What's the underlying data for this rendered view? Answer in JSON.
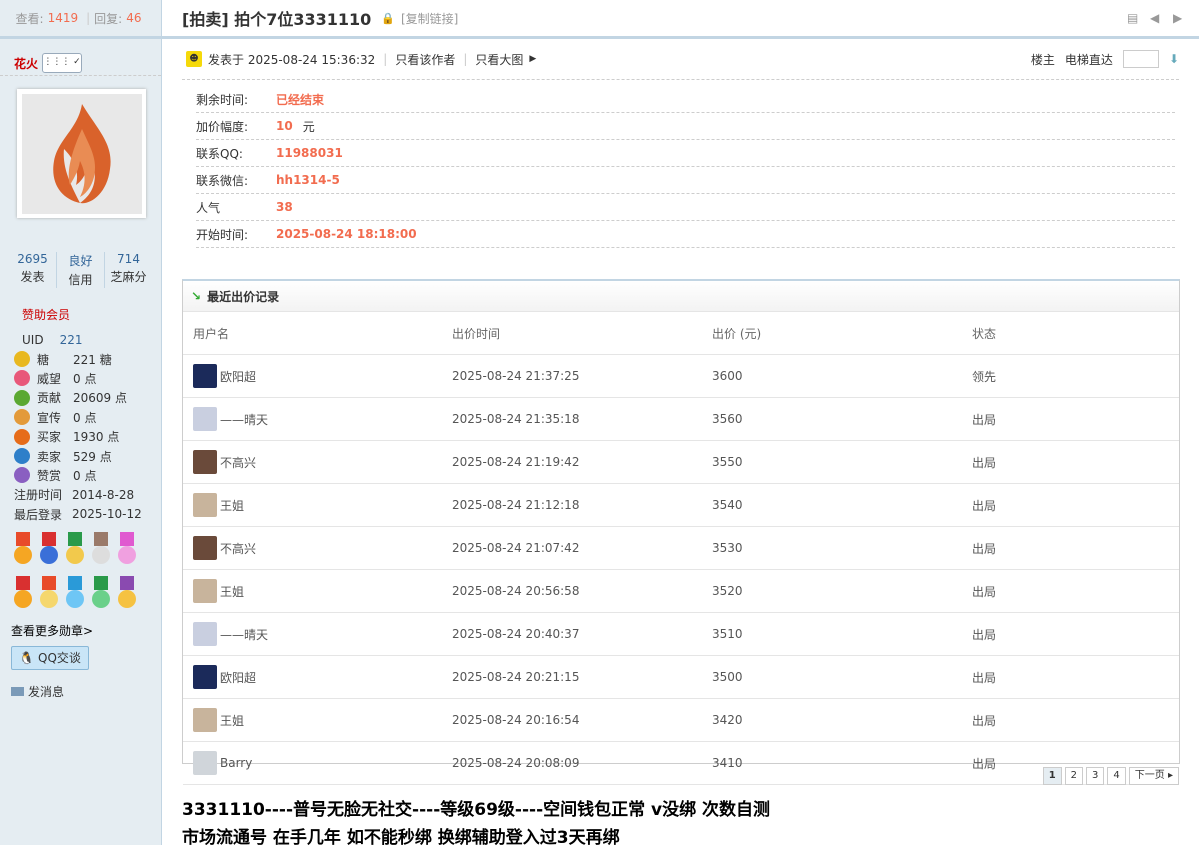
{
  "stats": {
    "views_label": "查看:",
    "views": "1419",
    "replies_label": "回复:",
    "replies": "46"
  },
  "user": {
    "name": "花火",
    "posts": "2695",
    "posts_label": "发表",
    "credit": "良好",
    "credit_label": "信用",
    "sesame": "714",
    "sesame_label": "芝麻分",
    "group": "赞助会员",
    "uid_label": "UID",
    "uid": "221",
    "info": [
      {
        "icon": "coin-icon",
        "color": "#e8b820",
        "k": "糖",
        "v": "221 糖"
      },
      {
        "icon": "heart-icon",
        "color": "#e8587a",
        "k": "威望",
        "v": "0 点"
      },
      {
        "icon": "sprout-icon",
        "color": "#5aa832",
        "k": "贡献",
        "v": "20609 点"
      },
      {
        "icon": "person-icon",
        "color": "#e39a3a",
        "k": "宣传",
        "v": "0 点"
      },
      {
        "icon": "gem-icon",
        "color": "#e66c1a",
        "k": "买家",
        "v": "1930 点"
      },
      {
        "icon": "diamond-icon",
        "color": "#2e7fc9",
        "k": "卖家",
        "v": "529 点"
      },
      {
        "icon": "crown-icon",
        "color": "#8a5fc1",
        "k": "赞赏",
        "v": "0 点"
      }
    ],
    "reg_label": "注册时间",
    "reg": "2014-8-28",
    "last_label": "最后登录",
    "last": "2025-10-12",
    "more_medals": "查看更多勋章>",
    "qq": "QQ交谈",
    "msg": "发消息"
  },
  "thread": {
    "title": "[拍卖] 拍个7位3331110",
    "copy": "[复制链接]",
    "posted": "发表于 2025-08-24 15:36:32",
    "only_author": "只看该作者",
    "big_image": "只看大图",
    "floor": "楼主",
    "elevator": "电梯直达"
  },
  "auction": [
    {
      "k": "剩余时间:",
      "v": "已经结束",
      "u": ""
    },
    {
      "k": "加价幅度:",
      "v": "10",
      "u": "元"
    },
    {
      "k": "联系QQ:",
      "v": "11988031",
      "u": ""
    },
    {
      "k": "联系微信:",
      "v": "hh1314-5",
      "u": ""
    },
    {
      "k": "人气",
      "v": "38",
      "u": ""
    },
    {
      "k": "开始时间:",
      "v": "2025-08-24 18:18:00",
      "u": ""
    }
  ],
  "bids": {
    "title": "最近出价记录",
    "headers": [
      "用户名",
      "出价时间",
      "出价 (元)",
      "状态"
    ],
    "rows": [
      {
        "user": "欧阳超",
        "time": "2025-08-24 21:37:25",
        "price": "3600",
        "status": "领先",
        "lead": true,
        "av": "#1b2a5a"
      },
      {
        "user": "——晴天",
        "time": "2025-08-24 21:35:18",
        "price": "3560",
        "status": "出局",
        "lead": false,
        "av": "#c9cfe0"
      },
      {
        "user": "不高兴",
        "time": "2025-08-24 21:19:42",
        "price": "3550",
        "status": "出局",
        "lead": false,
        "av": "#6a4a3a"
      },
      {
        "user": "王姐",
        "time": "2025-08-24 21:12:18",
        "price": "3540",
        "status": "出局",
        "lead": false,
        "av": "#c8b49c"
      },
      {
        "user": "不高兴",
        "time": "2025-08-24 21:07:42",
        "price": "3530",
        "status": "出局",
        "lead": false,
        "av": "#6a4a3a"
      },
      {
        "user": "王姐",
        "time": "2025-08-24 20:56:58",
        "price": "3520",
        "status": "出局",
        "lead": false,
        "av": "#c8b49c"
      },
      {
        "user": "——晴天",
        "time": "2025-08-24 20:40:37",
        "price": "3510",
        "status": "出局",
        "lead": false,
        "av": "#c9cfe0"
      },
      {
        "user": "欧阳超",
        "time": "2025-08-24 20:21:15",
        "price": "3500",
        "status": "出局",
        "lead": false,
        "av": "#1b2a5a"
      },
      {
        "user": "王姐",
        "time": "2025-08-24 20:16:54",
        "price": "3420",
        "status": "出局",
        "lead": false,
        "av": "#c8b49c"
      },
      {
        "user": "Barry",
        "time": "2025-08-24 20:08:09",
        "price": "3410",
        "status": "出局",
        "lead": false,
        "av": "#d0d5da"
      }
    ]
  },
  "pager": {
    "pages": [
      "1",
      "2",
      "3",
      "4"
    ],
    "next": "下一页"
  },
  "content": {
    "line1": "3331110----普号无脸无社交----等级69级----空间钱包正常 v没绑 次数自测",
    "line2": "市场流通号 在手几年  如不能秒绑  换绑辅助登入过3天再绑"
  }
}
